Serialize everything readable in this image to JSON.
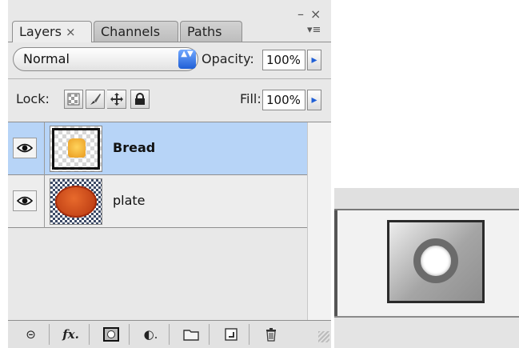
{
  "panel": {
    "tabs": [
      {
        "label": "Layers",
        "close": "×",
        "active": true
      },
      {
        "label": "Channels",
        "active": false
      },
      {
        "label": "Paths",
        "active": false
      }
    ],
    "window": {
      "minimize": "–",
      "close": "×",
      "flyout": "▾≡"
    },
    "blend_mode": {
      "value": "Normal",
      "arrows": "▲▼"
    },
    "opacity": {
      "label": "Opacity:",
      "value": "100%",
      "spin": "▸"
    },
    "lock": {
      "label": "Lock:",
      "icons": [
        "transparency-lock",
        "brush-lock",
        "move-lock",
        "padlock"
      ]
    },
    "fill": {
      "label": "Fill:",
      "value": "100%",
      "spin": "▸"
    },
    "layers": [
      {
        "name": "Bread",
        "selected": true,
        "visible": true
      },
      {
        "name": "plate",
        "selected": false,
        "visible": true
      }
    ],
    "footer": {
      "link_icon": "⊝",
      "fx_label": "fx.",
      "mask_icon": "◘",
      "adjust_icon": "◐.",
      "folder_icon": "▭",
      "new_icon": "◪",
      "trash_icon": "🗑"
    }
  },
  "colors": {
    "selected_row": "#b7d4f7",
    "panel_bg": "#e8e8e8",
    "accent_blue": "#1f5fd6"
  }
}
